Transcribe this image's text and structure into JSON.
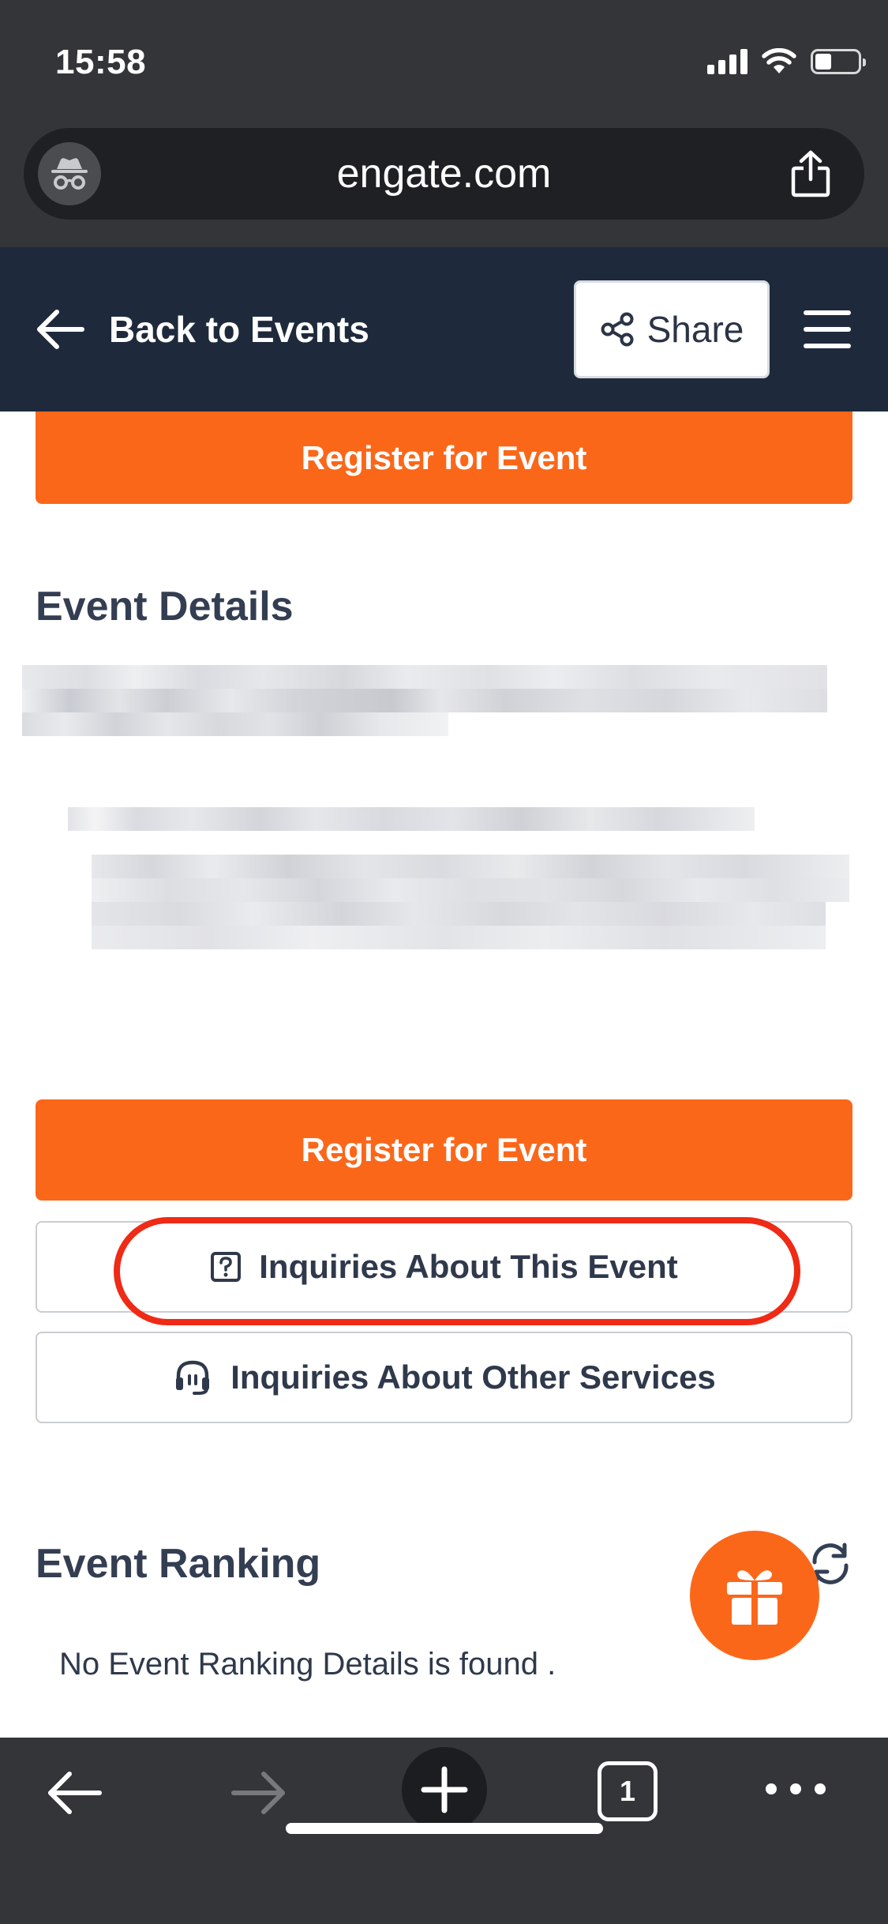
{
  "status_bar": {
    "time": "15:58"
  },
  "browser": {
    "url": "engate.com",
    "tab_count": "1"
  },
  "header": {
    "back_label": "Back to Events",
    "share_label": "Share"
  },
  "content": {
    "register_label": "Register for Event",
    "event_details_title": "Event Details",
    "inquiry_event_label": "Inquiries About This Event",
    "inquiry_other_label": "Inquiries About Other Services",
    "event_ranking_title": "Event Ranking",
    "no_ranking_text": "No Event Ranking Details is found ."
  },
  "colors": {
    "accent_orange": "#fb6719",
    "header_navy": "#1e2a3c",
    "highlight_red": "#ef2a16",
    "chrome_gray": "#333538"
  },
  "icons": [
    "incognito-icon",
    "share-upload-icon",
    "arrow-left-icon",
    "share-nodes-icon",
    "hamburger-menu-icon",
    "question-box-icon",
    "headset-icon",
    "refresh-icon",
    "gift-icon",
    "arrow-right-icon",
    "plus-icon",
    "more-dots-icon"
  ]
}
